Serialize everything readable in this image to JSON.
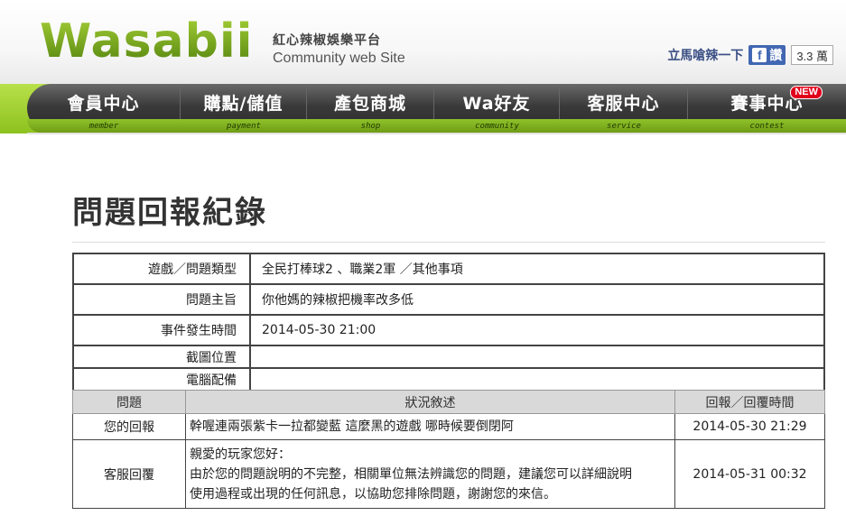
{
  "header": {
    "logo": "Wasabii",
    "subtitle_zh": "紅心辣椒娛樂平台",
    "subtitle_en": "Community web Site",
    "fb_prompt": "立馬嗆辣一下",
    "fb_like_label": "讚",
    "fb_like_count": "3.3 萬"
  },
  "nav": {
    "items": [
      {
        "zh": "會員中心",
        "en": "member"
      },
      {
        "zh": "購點/儲值",
        "en": "payment"
      },
      {
        "zh": "產包商城",
        "en": "shop"
      },
      {
        "zh": "Wa好友",
        "en": "community"
      },
      {
        "zh": "客服中心",
        "en": "service"
      },
      {
        "zh": "賽事中心",
        "en": "contest"
      }
    ],
    "new_badge": "NEW"
  },
  "page": {
    "title": "問題回報紀錄"
  },
  "info_table": {
    "rows": [
      {
        "label": "遊戲／問題類型",
        "value": "全民打棒球2 、職業2軍 ／其他事項"
      },
      {
        "label": "問題主旨",
        "value": "你他媽的辣椒把機率改多低"
      },
      {
        "label": "事件發生時間",
        "value": "2014-05-30 21:00"
      },
      {
        "label": "截圖位置",
        "value": ""
      },
      {
        "label": "電腦配備",
        "value": ""
      }
    ]
  },
  "reply_table": {
    "headers": [
      "問題",
      "狀況敘述",
      "回報／回覆時間"
    ],
    "rows": [
      {
        "who": "您的回報",
        "lines": [
          "幹喔連兩張紫卡一拉都變藍 這麼黑的遊戲 哪時候要倒閉阿"
        ],
        "time": "2014-05-30 21:29"
      },
      {
        "who": "客服回覆",
        "lines": [
          "親愛的玩家您好：",
          "由於您的問題說明的不完整，相關單位無法辨識您的問題，建議您可以詳細說明",
          "使用過程或出現的任何訊息，以協助您排除問題，謝謝您的來信。"
        ],
        "time": "2014-05-31 00:32"
      }
    ]
  },
  "colors": {
    "brand_green": "#8dc21f",
    "nav_dark": "#3a3a3a",
    "fb_blue": "#4267b2",
    "new_red": "#e0001b"
  }
}
